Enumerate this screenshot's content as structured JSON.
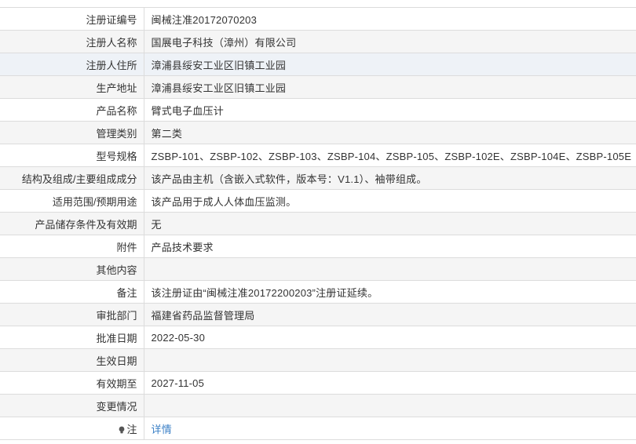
{
  "rows": [
    {
      "label": "注册证编号",
      "value": "闽械注准20172070203"
    },
    {
      "label": "注册人名称",
      "value": "国展电子科技（漳州）有限公司"
    },
    {
      "label": "注册人住所",
      "value": "漳浦县绥安工业区旧镇工业园"
    },
    {
      "label": "生产地址",
      "value": "漳浦县绥安工业区旧镇工业园"
    },
    {
      "label": "产品名称",
      "value": "臂式电子血压计"
    },
    {
      "label": "管理类别",
      "value": "第二类"
    },
    {
      "label": "型号规格",
      "value": "ZSBP-101、ZSBP-102、ZSBP-103、ZSBP-104、ZSBP-105、ZSBP-102E、ZSBP-104E、ZSBP-105E"
    },
    {
      "label": "结构及组成/主要组成成分",
      "value": "该产品由主机（含嵌入式软件，版本号：V1.1）、袖带组成。"
    },
    {
      "label": "适用范围/预期用途",
      "value": "该产品用于成人人体血压监测。"
    },
    {
      "label": "产品储存条件及有效期",
      "value": "无"
    },
    {
      "label": "附件",
      "value": "产品技术要求"
    },
    {
      "label": "其他内容",
      "value": ""
    },
    {
      "label": "备注",
      "value": "该注册证由“闽械注准20172200203”注册证延续。"
    },
    {
      "label": "审批部门",
      "value": "福建省药品监督管理局"
    },
    {
      "label": "批准日期",
      "value": "2022-05-30"
    },
    {
      "label": "生效日期",
      "value": ""
    },
    {
      "label": "有效期至",
      "value": "2027-11-05"
    },
    {
      "label": "变更情况",
      "value": ""
    }
  ],
  "note_row": {
    "label": "注",
    "link_text": "详情",
    "icon": "lightbulb-icon"
  },
  "colors": {
    "link": "#3a7fc6",
    "border": "#dcdcdc",
    "stripe": "#f5f5f5",
    "highlight": "#eef2f7"
  }
}
